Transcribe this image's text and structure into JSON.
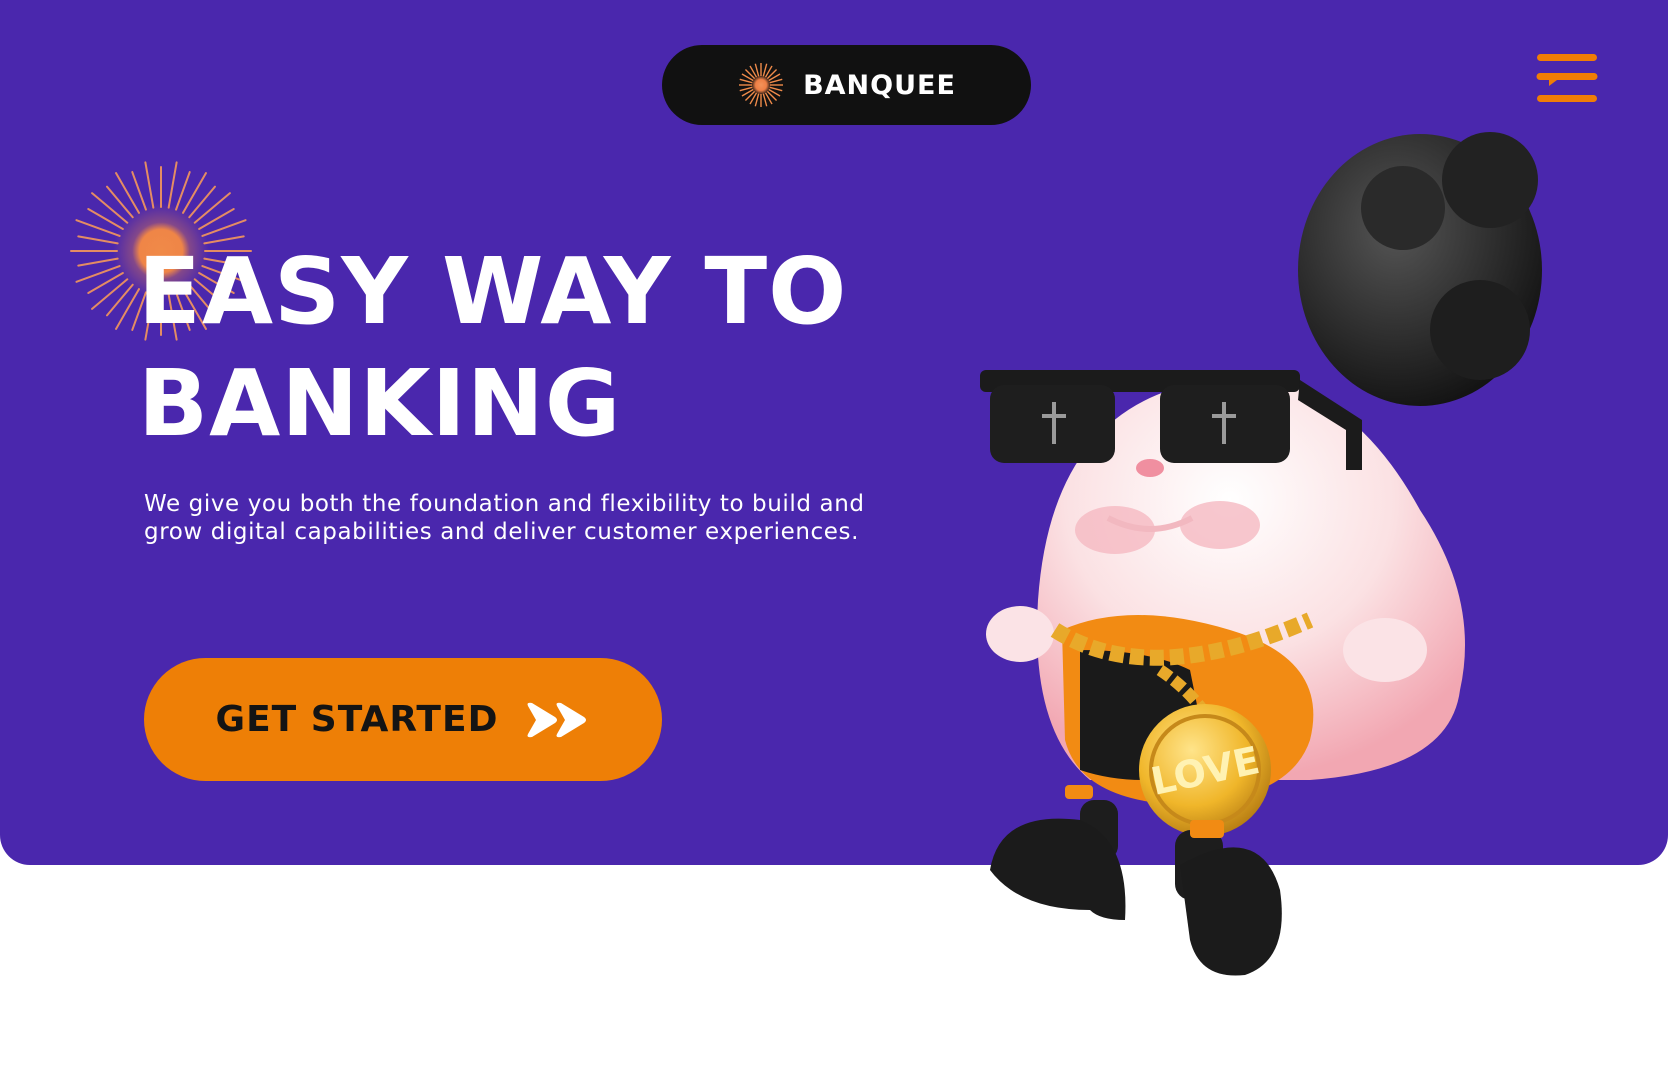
{
  "brand": {
    "name": "BANQUEE",
    "logo_icon": "orange-sunburst-icon",
    "logo_color": "#f08b4a"
  },
  "header": {
    "menu_icon": "hamburger-chat-menu-icon",
    "menu_icon_color": "#f07d06"
  },
  "hero": {
    "headline_line1": "EASY WAY TO",
    "headline_line2": "BANKING",
    "description": "We give you both the foundation and flexibility to build and grow digital capabilities and deliver customer experiences.",
    "background_color": "#4a27ad",
    "decoration_icon": "sunburst-icon"
  },
  "cta": {
    "label": "GET STARTED",
    "icon": "double-chevron-right-icon",
    "background_color": "#ee7f06",
    "text_color": "#141414"
  },
  "mascot": {
    "description_icon": "bunny-mascot-illustration",
    "medallion_text": "LOVE"
  }
}
